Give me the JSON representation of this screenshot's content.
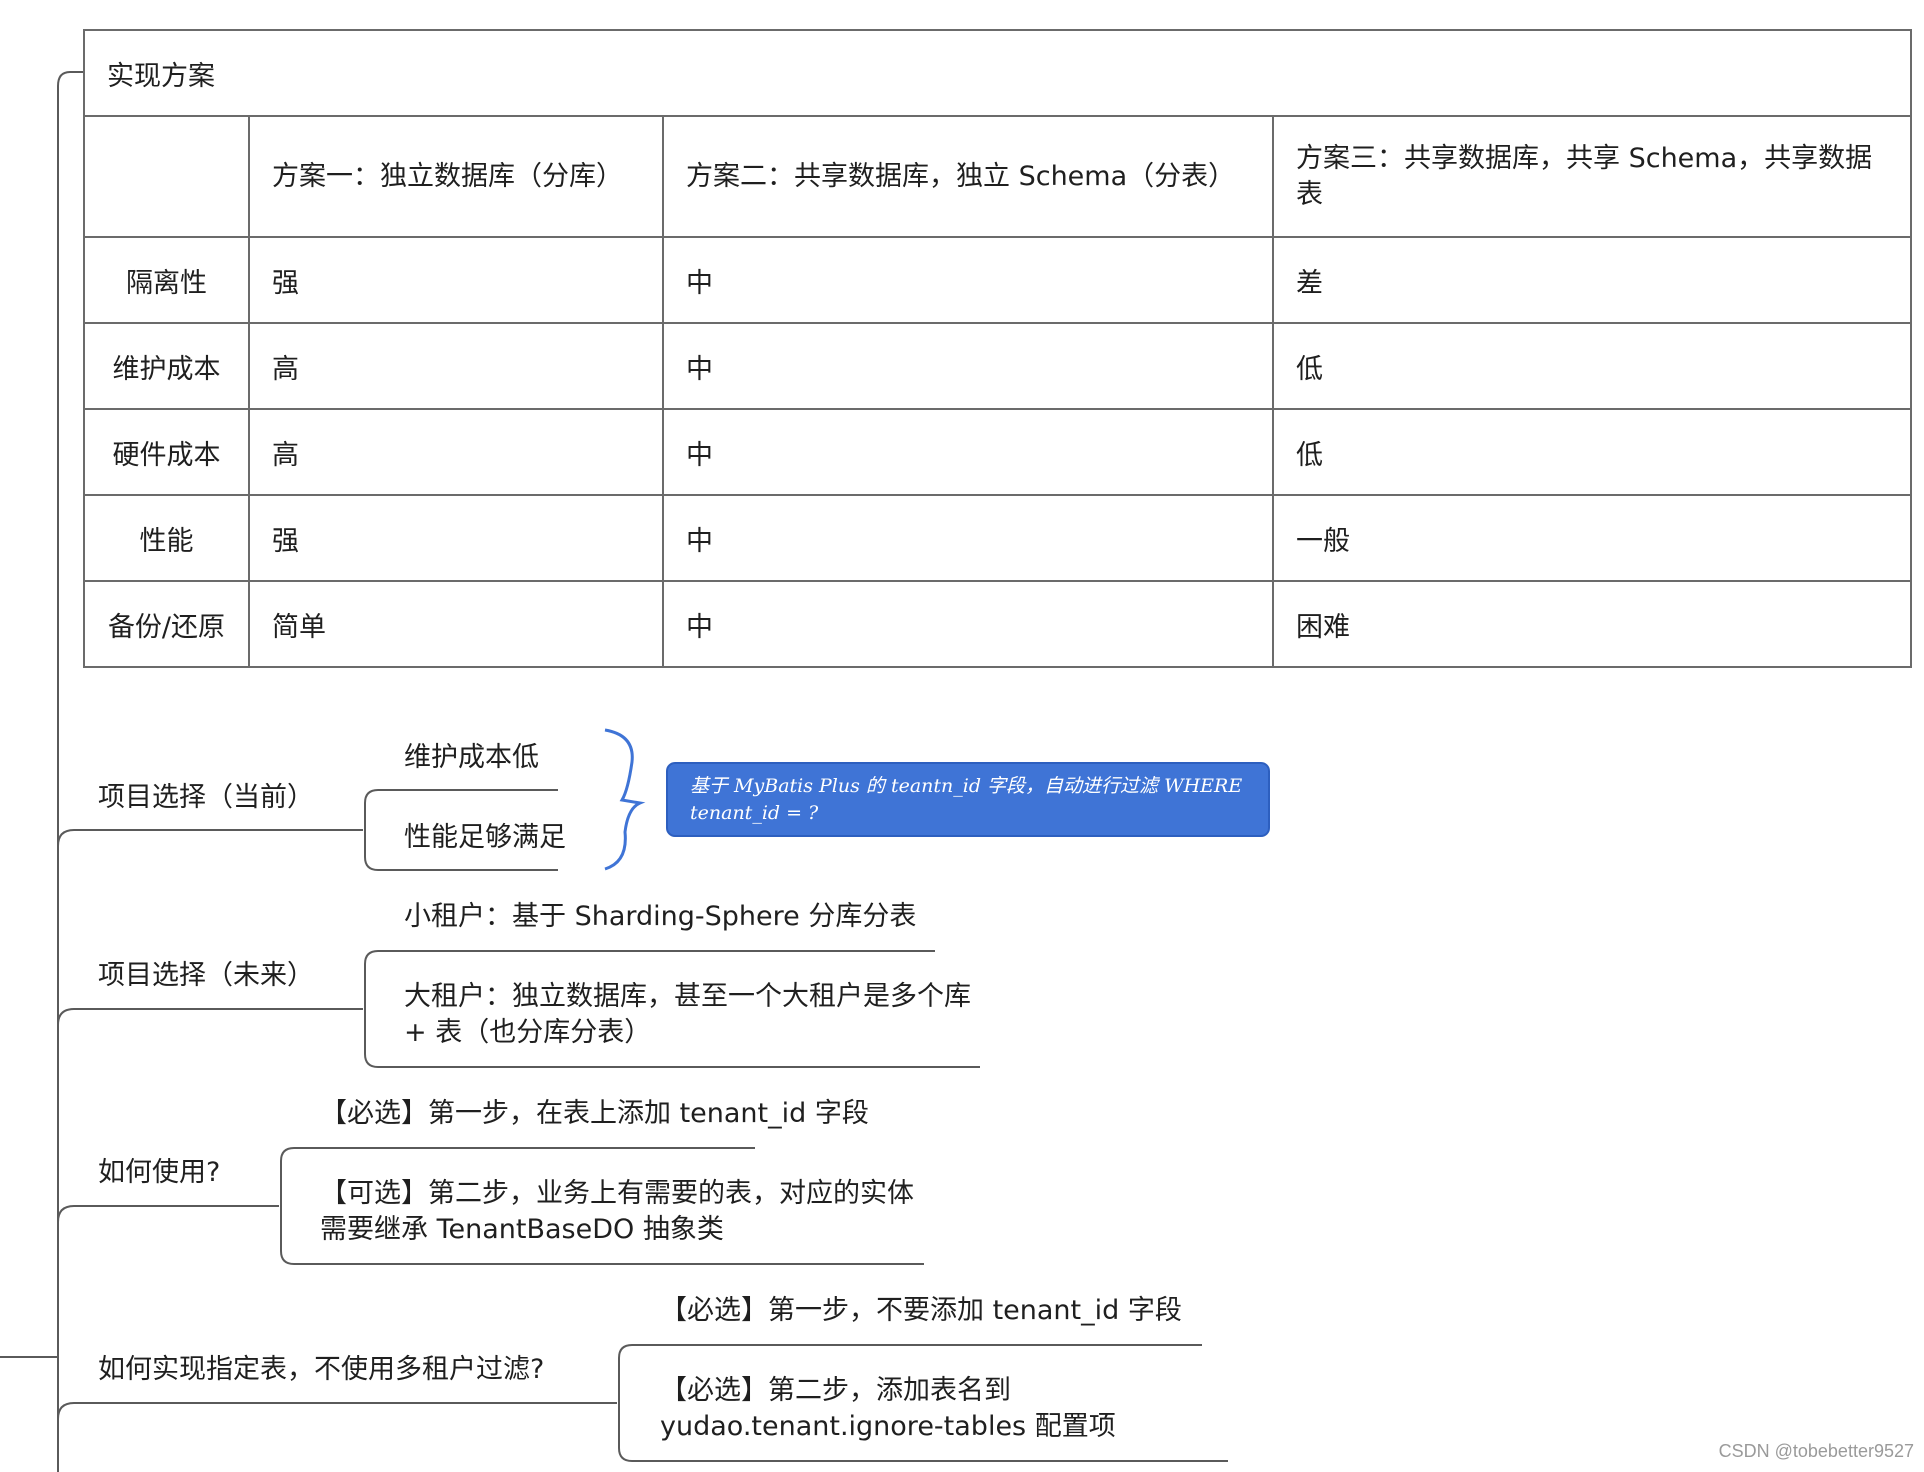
{
  "table": {
    "title": "实现方案",
    "columns": [
      "",
      "方案一：独立数据库（分库）",
      "方案二：共享数据库，独立 Schema（分表）",
      "方案三：共享数据库，共享 Schema，共享数据表"
    ],
    "rows": [
      {
        "label": "隔离性",
        "values": [
          "强",
          "中",
          "差"
        ]
      },
      {
        "label": "维护成本",
        "values": [
          "高",
          "中",
          "低"
        ]
      },
      {
        "label": "硬件成本",
        "values": [
          "高",
          "中",
          "低"
        ]
      },
      {
        "label": "性能",
        "values": [
          "强",
          "中",
          "一般"
        ]
      },
      {
        "label": "备份/还原",
        "values": [
          "简单",
          "中",
          "困难"
        ]
      }
    ]
  },
  "branches": {
    "current": {
      "label": "项目选择（当前）",
      "items": [
        "维护成本低",
        "性能足够满足"
      ],
      "note": "基于 MyBatis Plus 的 teantn_id 字段，自动进行过滤 WHERE tenant_id = ?"
    },
    "future": {
      "label": "项目选择（未来）",
      "items": [
        "小租户：基于 Sharding-Sphere 分库分表",
        "大租户：独立数据库，甚至一个大租户是多个库 + 表（也分库分表）"
      ]
    },
    "usage": {
      "label": "如何使用?",
      "items": [
        "【必选】第一步，在表上添加 tenant_id 字段",
        "【可选】第二步，业务上有需要的表，对应的实体需要继承 TenantBaseDO 抽象类"
      ]
    },
    "ignore": {
      "label": "如何实现指定表，不使用多租户过滤?",
      "items": [
        "【必选】第一步，不要添加 tenant_id 字段",
        "【必选】第二步，添加表名到 yudao.tenant.ignore-tables 配置项"
      ]
    }
  },
  "watermark": "CSDN @tobebetter9527",
  "colors": {
    "line": "#5a5a5a",
    "brace": "#3f74d6",
    "note_bg": "#3f74d6",
    "border": "#6b6b6b"
  }
}
